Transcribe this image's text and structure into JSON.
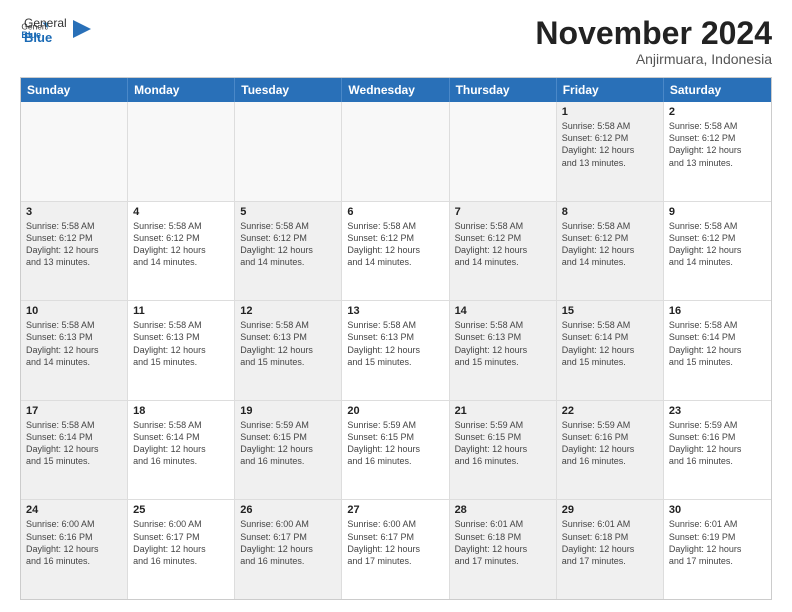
{
  "logo": {
    "general": "General",
    "blue": "Blue"
  },
  "header": {
    "month": "November 2024",
    "location": "Anjirmuara, Indonesia"
  },
  "weekdays": [
    "Sunday",
    "Monday",
    "Tuesday",
    "Wednesday",
    "Thursday",
    "Friday",
    "Saturday"
  ],
  "rows": [
    [
      {
        "day": "",
        "text": "",
        "empty": true
      },
      {
        "day": "",
        "text": "",
        "empty": true
      },
      {
        "day": "",
        "text": "",
        "empty": true
      },
      {
        "day": "",
        "text": "",
        "empty": true
      },
      {
        "day": "",
        "text": "",
        "empty": true
      },
      {
        "day": "1",
        "text": "Sunrise: 5:58 AM\nSunset: 6:12 PM\nDaylight: 12 hours\nand 13 minutes.",
        "shaded": true
      },
      {
        "day": "2",
        "text": "Sunrise: 5:58 AM\nSunset: 6:12 PM\nDaylight: 12 hours\nand 13 minutes."
      }
    ],
    [
      {
        "day": "3",
        "text": "Sunrise: 5:58 AM\nSunset: 6:12 PM\nDaylight: 12 hours\nand 13 minutes.",
        "shaded": true
      },
      {
        "day": "4",
        "text": "Sunrise: 5:58 AM\nSunset: 6:12 PM\nDaylight: 12 hours\nand 14 minutes."
      },
      {
        "day": "5",
        "text": "Sunrise: 5:58 AM\nSunset: 6:12 PM\nDaylight: 12 hours\nand 14 minutes.",
        "shaded": true
      },
      {
        "day": "6",
        "text": "Sunrise: 5:58 AM\nSunset: 6:12 PM\nDaylight: 12 hours\nand 14 minutes."
      },
      {
        "day": "7",
        "text": "Sunrise: 5:58 AM\nSunset: 6:12 PM\nDaylight: 12 hours\nand 14 minutes.",
        "shaded": true
      },
      {
        "day": "8",
        "text": "Sunrise: 5:58 AM\nSunset: 6:12 PM\nDaylight: 12 hours\nand 14 minutes.",
        "shaded": true
      },
      {
        "day": "9",
        "text": "Sunrise: 5:58 AM\nSunset: 6:12 PM\nDaylight: 12 hours\nand 14 minutes."
      }
    ],
    [
      {
        "day": "10",
        "text": "Sunrise: 5:58 AM\nSunset: 6:13 PM\nDaylight: 12 hours\nand 14 minutes.",
        "shaded": true
      },
      {
        "day": "11",
        "text": "Sunrise: 5:58 AM\nSunset: 6:13 PM\nDaylight: 12 hours\nand 15 minutes."
      },
      {
        "day": "12",
        "text": "Sunrise: 5:58 AM\nSunset: 6:13 PM\nDaylight: 12 hours\nand 15 minutes.",
        "shaded": true
      },
      {
        "day": "13",
        "text": "Sunrise: 5:58 AM\nSunset: 6:13 PM\nDaylight: 12 hours\nand 15 minutes."
      },
      {
        "day": "14",
        "text": "Sunrise: 5:58 AM\nSunset: 6:13 PM\nDaylight: 12 hours\nand 15 minutes.",
        "shaded": true
      },
      {
        "day": "15",
        "text": "Sunrise: 5:58 AM\nSunset: 6:14 PM\nDaylight: 12 hours\nand 15 minutes.",
        "shaded": true
      },
      {
        "day": "16",
        "text": "Sunrise: 5:58 AM\nSunset: 6:14 PM\nDaylight: 12 hours\nand 15 minutes."
      }
    ],
    [
      {
        "day": "17",
        "text": "Sunrise: 5:58 AM\nSunset: 6:14 PM\nDaylight: 12 hours\nand 15 minutes.",
        "shaded": true
      },
      {
        "day": "18",
        "text": "Sunrise: 5:58 AM\nSunset: 6:14 PM\nDaylight: 12 hours\nand 16 minutes."
      },
      {
        "day": "19",
        "text": "Sunrise: 5:59 AM\nSunset: 6:15 PM\nDaylight: 12 hours\nand 16 minutes.",
        "shaded": true
      },
      {
        "day": "20",
        "text": "Sunrise: 5:59 AM\nSunset: 6:15 PM\nDaylight: 12 hours\nand 16 minutes."
      },
      {
        "day": "21",
        "text": "Sunrise: 5:59 AM\nSunset: 6:15 PM\nDaylight: 12 hours\nand 16 minutes.",
        "shaded": true
      },
      {
        "day": "22",
        "text": "Sunrise: 5:59 AM\nSunset: 6:16 PM\nDaylight: 12 hours\nand 16 minutes.",
        "shaded": true
      },
      {
        "day": "23",
        "text": "Sunrise: 5:59 AM\nSunset: 6:16 PM\nDaylight: 12 hours\nand 16 minutes."
      }
    ],
    [
      {
        "day": "24",
        "text": "Sunrise: 6:00 AM\nSunset: 6:16 PM\nDaylight: 12 hours\nand 16 minutes.",
        "shaded": true
      },
      {
        "day": "25",
        "text": "Sunrise: 6:00 AM\nSunset: 6:17 PM\nDaylight: 12 hours\nand 16 minutes."
      },
      {
        "day": "26",
        "text": "Sunrise: 6:00 AM\nSunset: 6:17 PM\nDaylight: 12 hours\nand 16 minutes.",
        "shaded": true
      },
      {
        "day": "27",
        "text": "Sunrise: 6:00 AM\nSunset: 6:17 PM\nDaylight: 12 hours\nand 17 minutes."
      },
      {
        "day": "28",
        "text": "Sunrise: 6:01 AM\nSunset: 6:18 PM\nDaylight: 12 hours\nand 17 minutes.",
        "shaded": true
      },
      {
        "day": "29",
        "text": "Sunrise: 6:01 AM\nSunset: 6:18 PM\nDaylight: 12 hours\nand 17 minutes.",
        "shaded": true
      },
      {
        "day": "30",
        "text": "Sunrise: 6:01 AM\nSunset: 6:19 PM\nDaylight: 12 hours\nand 17 minutes."
      }
    ]
  ]
}
